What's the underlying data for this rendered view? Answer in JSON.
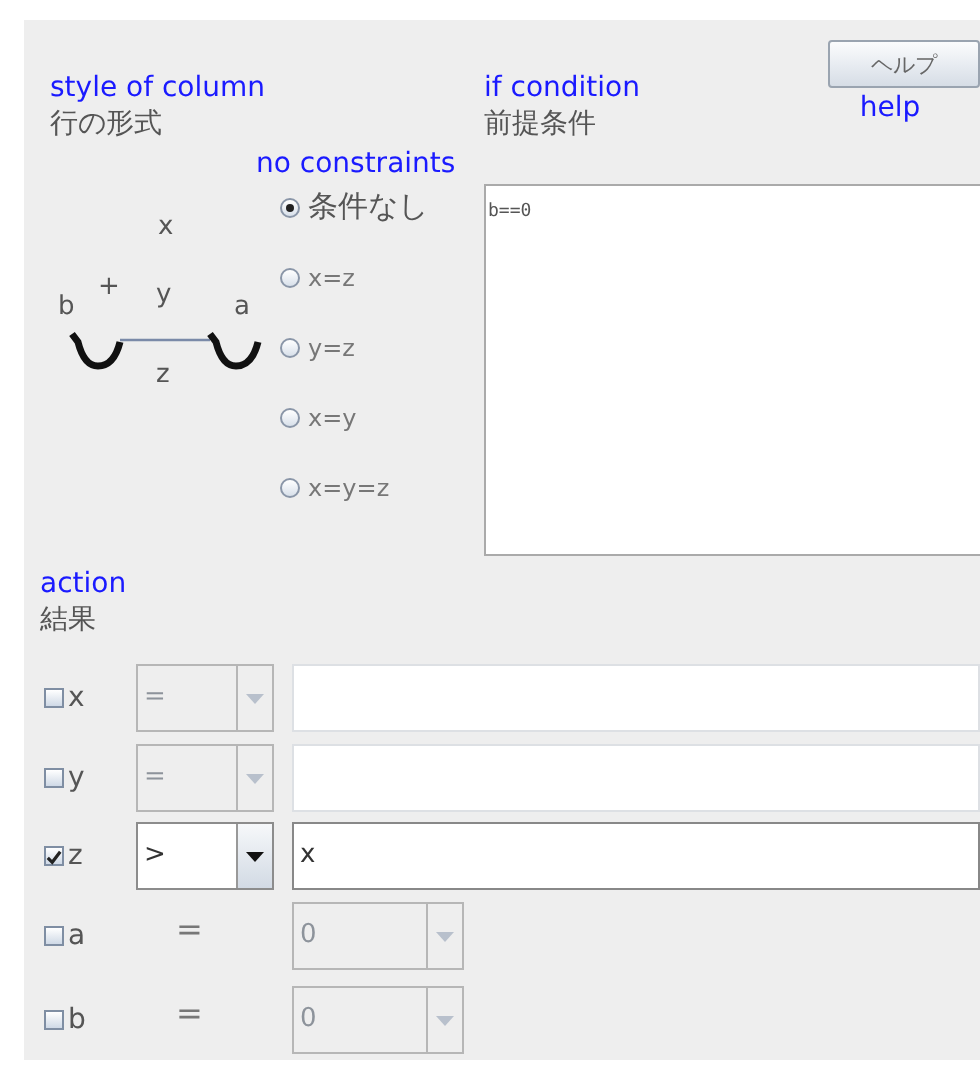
{
  "column_style": {
    "caption": "style of column",
    "title": "行の形式",
    "diagram": {
      "top": "x",
      "plus": "+",
      "middle": "y",
      "left": "b",
      "right": "a",
      "bottom": "z"
    }
  },
  "constraints": {
    "caption": "no constraints",
    "options": [
      {
        "label": "条件なし",
        "selected": true
      },
      {
        "label": "x=z",
        "selected": false
      },
      {
        "label": "y=z",
        "selected": false
      },
      {
        "label": "x=y",
        "selected": false
      },
      {
        "label": "x=y=z",
        "selected": false
      }
    ]
  },
  "condition": {
    "caption": "if condition",
    "title": "前提条件",
    "value": "b==0"
  },
  "help": {
    "label": "ヘルプ",
    "caption": "help"
  },
  "action": {
    "caption": "action",
    "title": "結果",
    "rows": [
      {
        "kind": "expression",
        "label": "x",
        "checked": false,
        "operator": "="
      },
      {
        "kind": "expression",
        "label": "y",
        "checked": false,
        "operator": "="
      },
      {
        "kind": "expression",
        "label": "z",
        "checked": true,
        "operator": ">",
        "value": "x"
      },
      {
        "kind": "constant",
        "label": "a",
        "checked": false,
        "operator": "=",
        "value": "0"
      },
      {
        "kind": "constant",
        "label": "b",
        "checked": false,
        "operator": "=",
        "value": "0"
      }
    ]
  }
}
